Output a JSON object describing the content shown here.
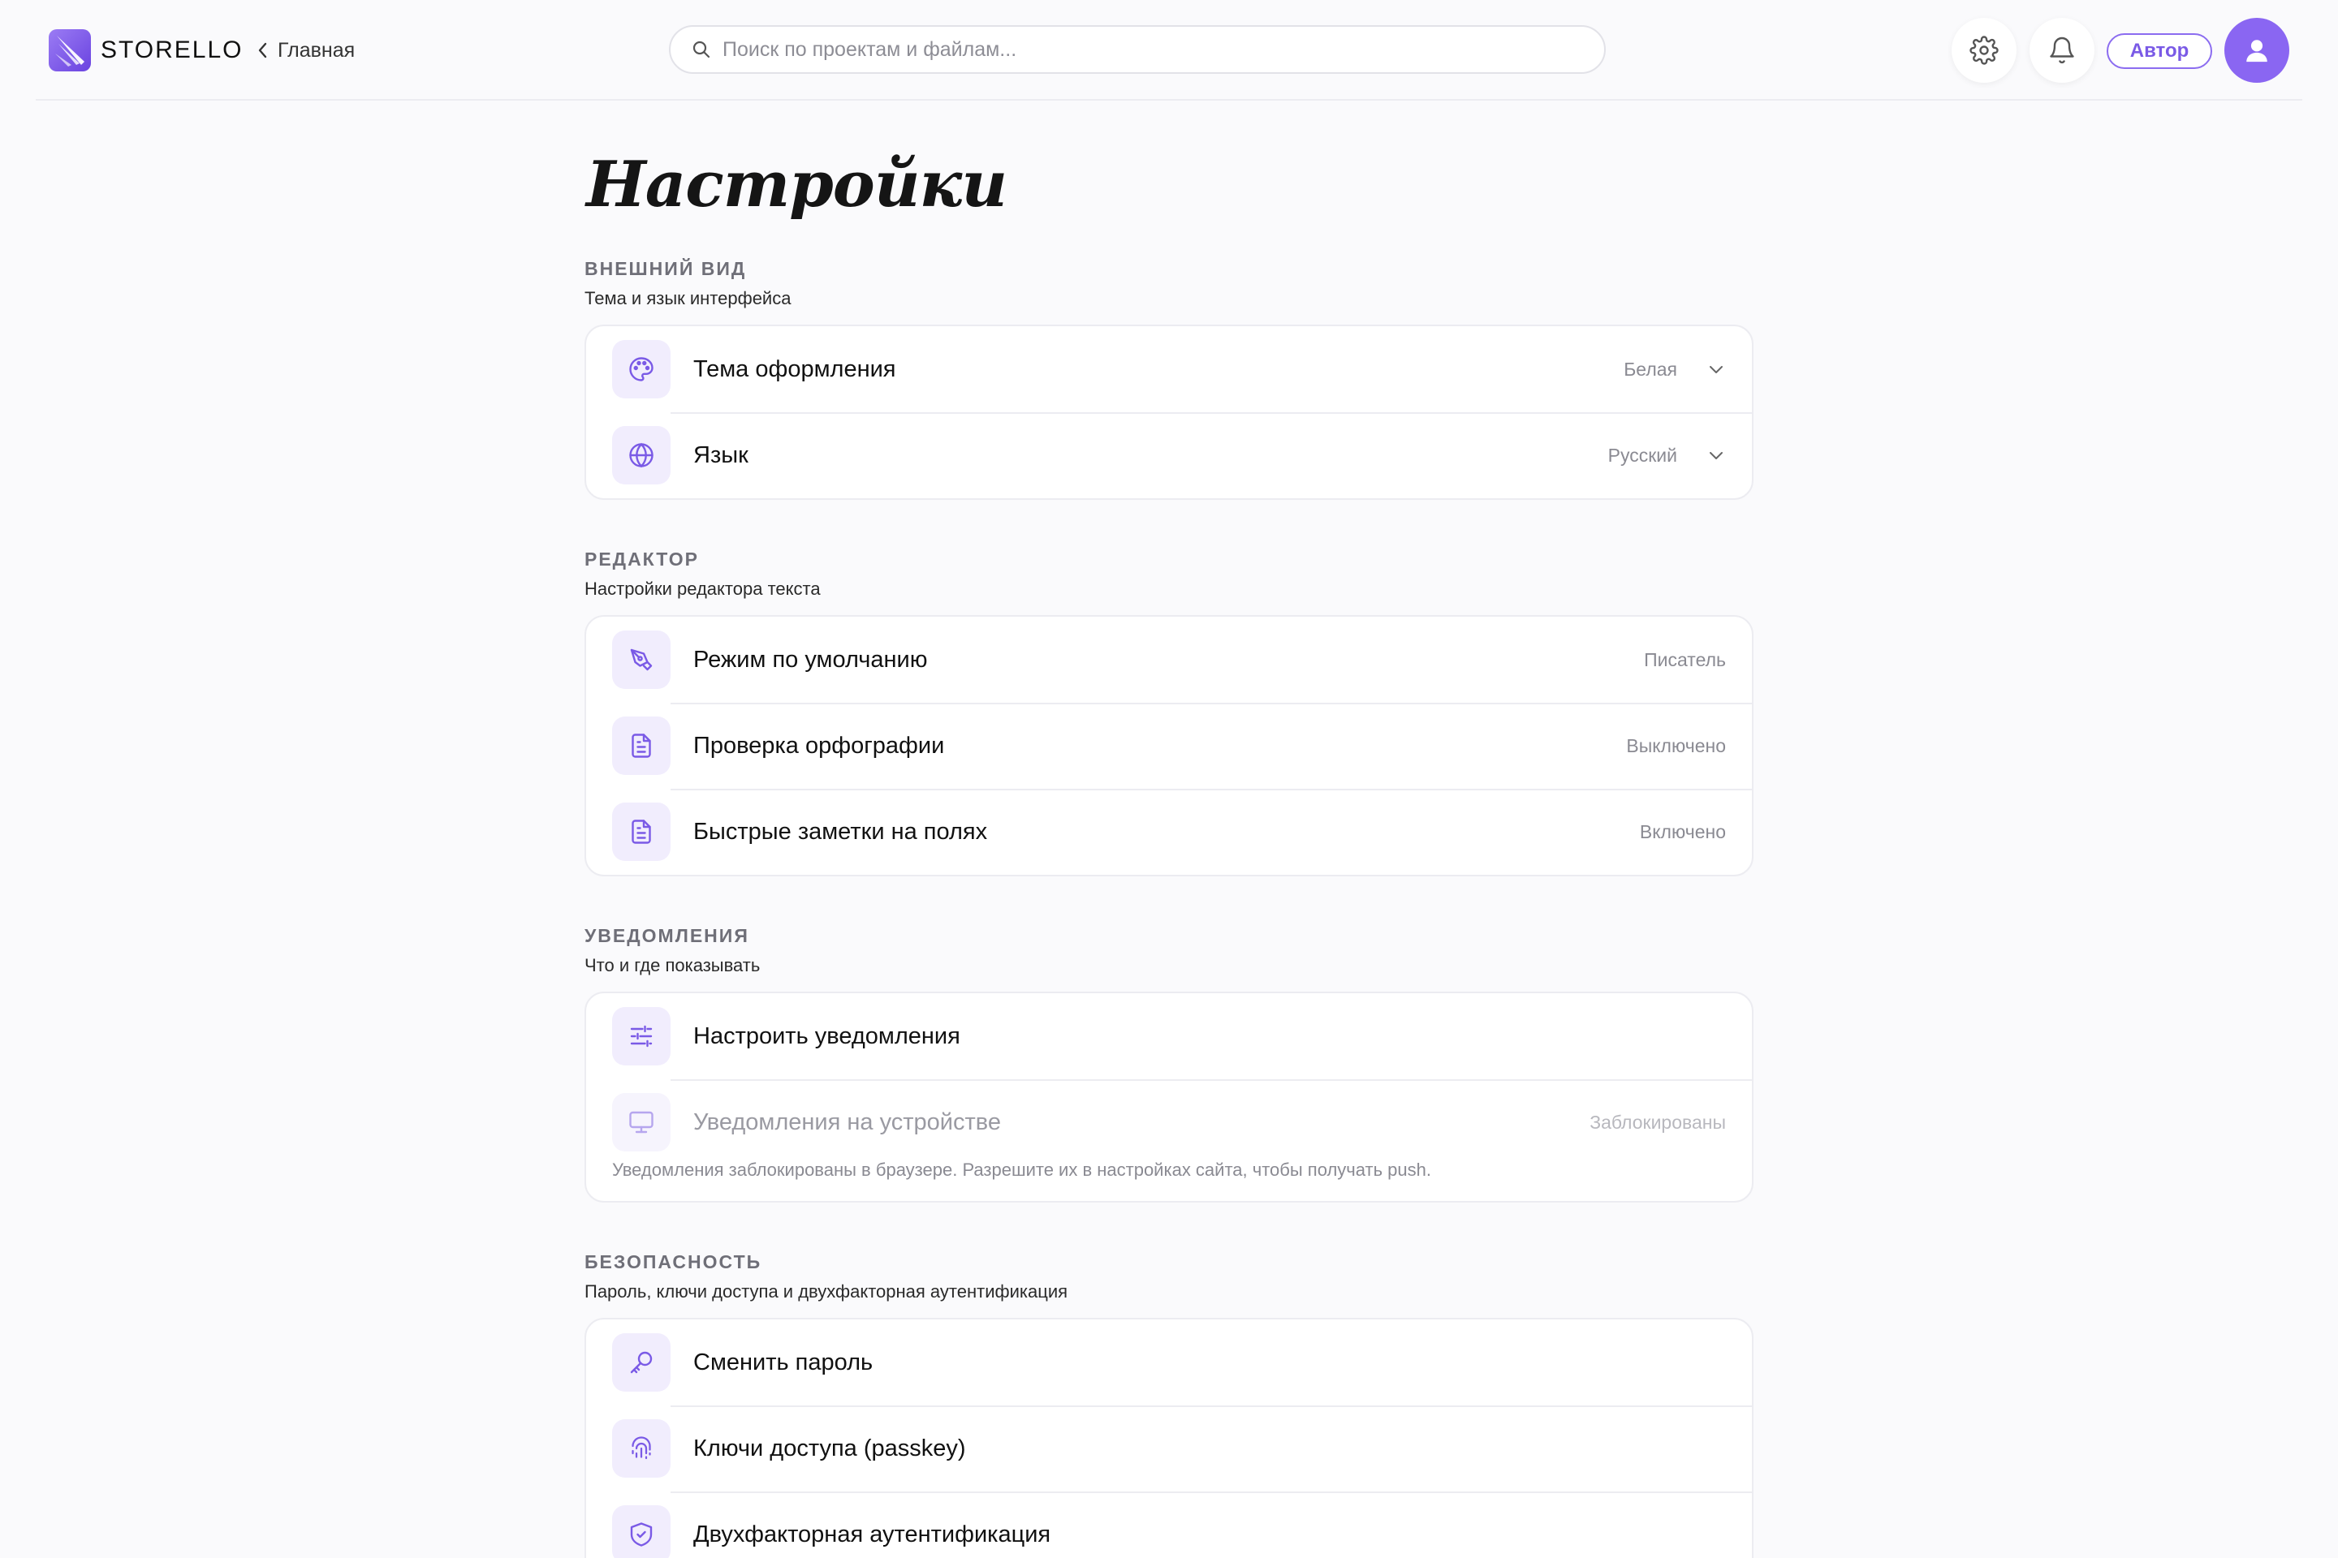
{
  "header": {
    "brand": "STORELLO",
    "back_label": "Главная",
    "search_placeholder": "Поиск по проектам и файлам...",
    "author_button": "Автор"
  },
  "page": {
    "title": "Настройки"
  },
  "sections": [
    {
      "title": "ВНЕШНИЙ ВИД",
      "subtitle": "Тема и язык интерфейса",
      "rows": [
        {
          "label": "Тема оформления",
          "value": "Белая",
          "icon": "palette-icon",
          "dropdown": true
        },
        {
          "label": "Язык",
          "value": "Русский",
          "icon": "globe-icon",
          "dropdown": true
        }
      ]
    },
    {
      "title": "РЕДАКТОР",
      "subtitle": "Настройки редактора текста",
      "rows": [
        {
          "label": "Режим по умолчанию",
          "value": "Писатель",
          "icon": "pen-tool-icon"
        },
        {
          "label": "Проверка орфографии",
          "value": "Выключено",
          "icon": "document-icon"
        },
        {
          "label": "Быстрые заметки на полях",
          "value": "Включено",
          "icon": "document-icon"
        }
      ]
    },
    {
      "title": "УВЕДОМЛЕНИЯ",
      "subtitle": "Что и где показывать",
      "rows": [
        {
          "label": "Настроить уведомления",
          "value": "",
          "icon": "sliders-icon"
        },
        {
          "label": "Уведомления на устройстве",
          "value": "Заблокированы",
          "icon": "monitor-icon",
          "disabled": true
        }
      ],
      "note": "Уведомления заблокированы в браузере. Разрешите их в настройках сайта, чтобы получать push."
    },
    {
      "title": "БЕЗОПАСНОСТЬ",
      "subtitle": "Пароль, ключи доступа и двухфакторная аутентификация",
      "rows": [
        {
          "label": "Сменить пароль",
          "value": "",
          "icon": "key-icon"
        },
        {
          "label": "Ключи доступа (passkey)",
          "value": "",
          "icon": "fingerprint-icon"
        },
        {
          "label": "Двухфакторная аутентификация",
          "value": "",
          "icon": "shield-check-icon"
        }
      ]
    }
  ],
  "colors": {
    "accent": "#8a66f2",
    "icon_bg": "#f1edfd",
    "background": "#fafafc"
  }
}
